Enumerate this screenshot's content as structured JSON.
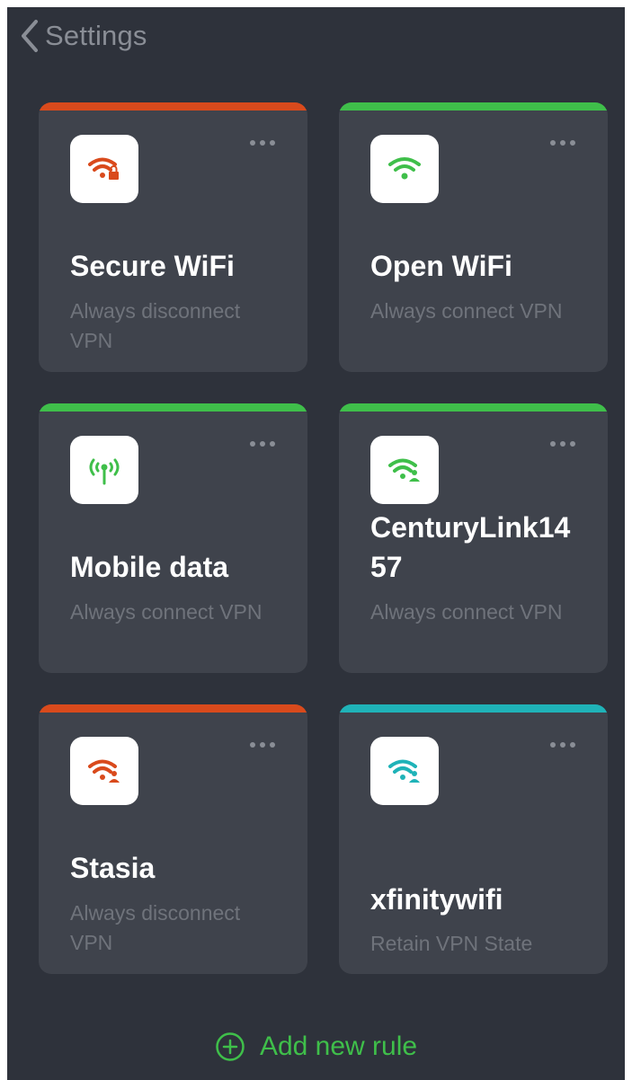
{
  "header": {
    "back_label": "Settings",
    "back_icon": "chevron-left-icon"
  },
  "colors": {
    "background": "#2e323b",
    "card": "#3f434c",
    "red": "#d94a1c",
    "green": "#3fbf4a",
    "teal": "#1fb3b8"
  },
  "cards": [
    {
      "title": "Secure WiFi",
      "subtitle": "Always disconnect VPN",
      "status": "red",
      "icon": "wifi-lock-icon"
    },
    {
      "title": "Open WiFi",
      "subtitle": "Always connect VPN",
      "status": "green",
      "icon": "wifi-icon"
    },
    {
      "title": "Mobile data",
      "subtitle": "Always connect VPN",
      "status": "green",
      "icon": "cellular-antenna-icon"
    },
    {
      "title": "CenturyLink1457",
      "subtitle": "Always connect VPN",
      "status": "green",
      "icon": "wifi-users-icon"
    },
    {
      "title": "Stasia",
      "subtitle": "Always disconnect VPN",
      "status": "red",
      "icon": "wifi-users-icon"
    },
    {
      "title": "xfinitywifi",
      "subtitle": "Retain VPN State",
      "status": "teal",
      "icon": "wifi-users-icon"
    }
  ],
  "add_rule": {
    "label": "Add new rule",
    "icon": "plus-circle-icon"
  }
}
